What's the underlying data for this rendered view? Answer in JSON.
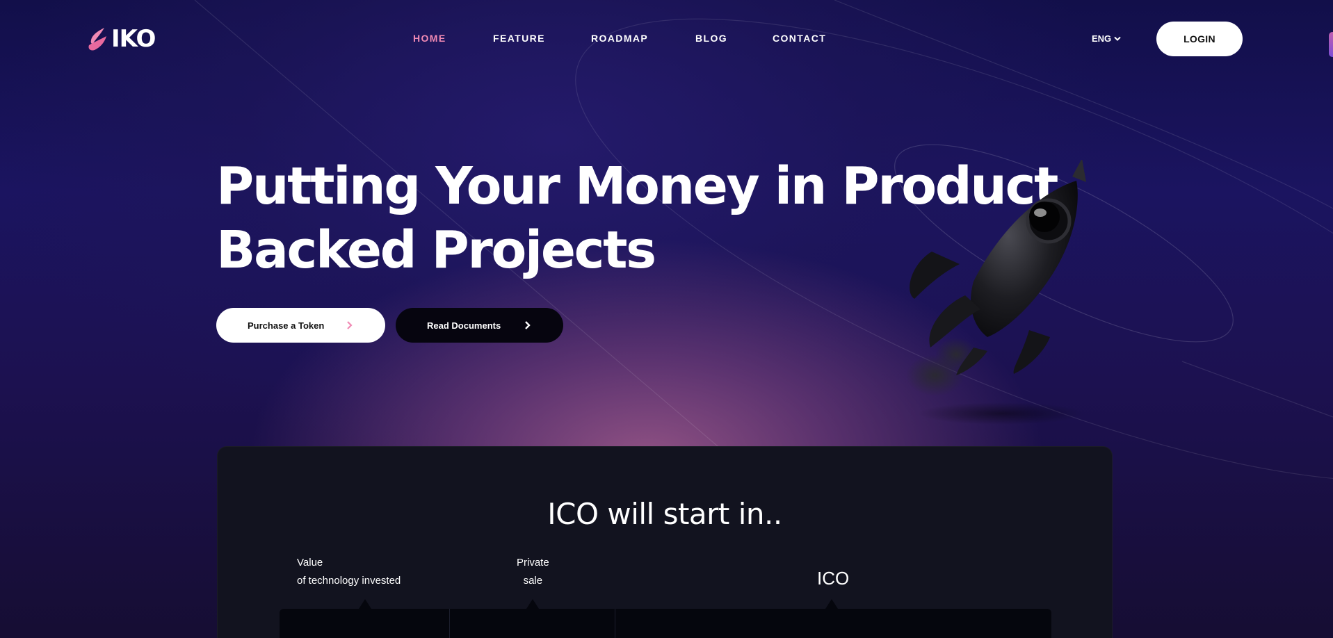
{
  "brand": {
    "name": "IKO"
  },
  "nav": {
    "items": [
      "HOME",
      "FEATURE",
      "ROADMAP",
      "BLOG",
      "CONTACT"
    ],
    "active": "HOME"
  },
  "header": {
    "language": "ENG",
    "login_label": "LOGIN"
  },
  "hero": {
    "title_line1": "Putting Your Money in Product",
    "title_line2": "Backed Projects",
    "primary_button": "Purchase a Token",
    "secondary_button": "Read Documents"
  },
  "ico": {
    "title": "ICO will start in..",
    "stages": [
      {
        "line1": "Value",
        "line2": "of technology invested"
      },
      {
        "line1": "Private",
        "line2": "sale"
      },
      {
        "line1": "ICO",
        "line2": ""
      }
    ]
  },
  "colors": {
    "accent_pink": "#f08ab4",
    "background_navy": "#120f4a",
    "panel_dark": "#12131f",
    "button_dark": "#06050f"
  },
  "icons": {
    "logo": "flame-logo-icon",
    "language_dropdown": "chevron-down-icon",
    "button_arrow": "chevron-right-icon",
    "hero_image": "rocket-illustration"
  }
}
